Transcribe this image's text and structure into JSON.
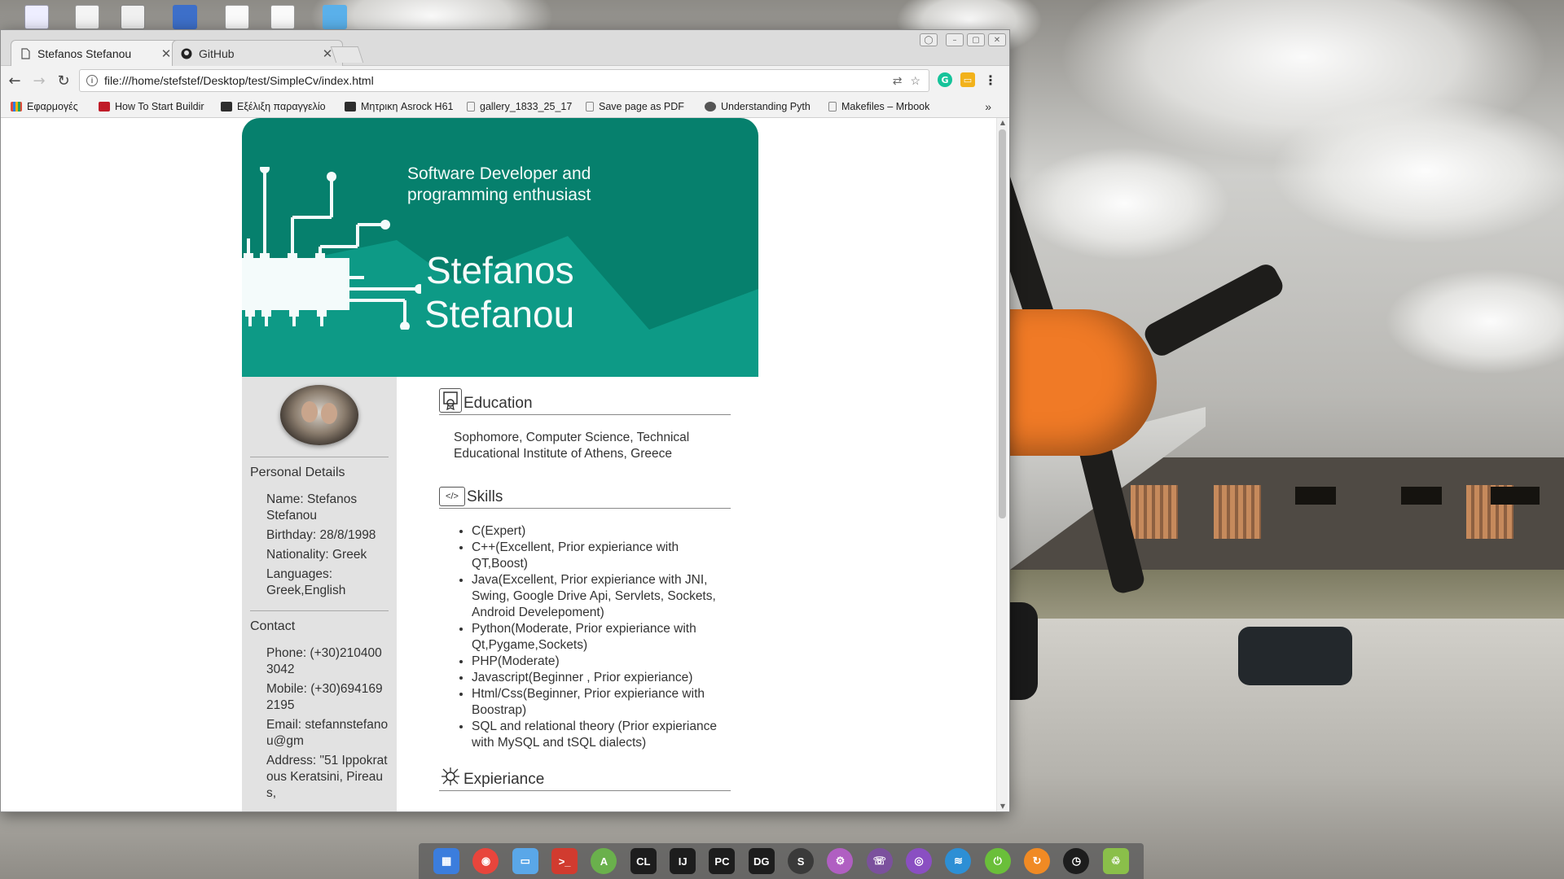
{
  "browser": {
    "tabs": [
      {
        "title": "Stefanos Stefanou",
        "active": true
      },
      {
        "title": "GitHub",
        "active": false
      }
    ],
    "url": "file:///home/stefstef/Desktop/test/SimpleCv/index.html",
    "bookmarks": [
      {
        "label": "Εφαρμογές",
        "icon": "apps-grid-icon",
        "color": "#e04a3a"
      },
      {
        "label": "How To Start Buildir",
        "icon": "bookmark-favicon",
        "color": "#c01c28"
      },
      {
        "label": "Εξέλιξη παραγγελίο",
        "icon": "bookmark-favicon",
        "color": "#2d2d2d"
      },
      {
        "label": "Μητρικη Asrock H61",
        "icon": "bookmark-favicon",
        "color": "#2d2d2d"
      },
      {
        "label": "gallery_1833_25_17",
        "icon": "page-icon",
        "color": "#888888"
      },
      {
        "label": "Save page as PDF",
        "icon": "page-icon",
        "color": "#888888"
      },
      {
        "label": "Understanding Pyth",
        "icon": "person-favicon",
        "color": "#555555"
      },
      {
        "label": "Makefiles – Mrbook",
        "icon": "page-icon",
        "color": "#888888"
      }
    ],
    "more_label": "»"
  },
  "cv": {
    "tagline": "Software Developer and programming enthusiast",
    "first_name": "Stefanos",
    "last_name": "Stefanou",
    "personal_heading": "Personal Details",
    "personal": [
      "Name: Stefanos Stefanou",
      "Birthday: 28/8/1998",
      "Nationality: Greek",
      "Languages: Greek,English"
    ],
    "contact_heading": "Contact",
    "contact": [
      "Phone: (+30)2104003042",
      "Mobile: (+30)6941692195",
      "Email: stefannstefanou@gm",
      "Address: \"51 Ippokratous Keratsini, Pireaus,"
    ],
    "education_heading": "Education",
    "education_text": "Sophomore, Computer Science, Technical Educational Institute of Athens, Greece",
    "skills_heading": "Skills",
    "skills": [
      "C(Expert)",
      "C++(Excellent, Prior expieriance with QT,Boost)",
      "Java(Excellent, Prior expieriance with JNI, Swing, Google Drive Api, Servlets, Sockets, Android Develepoment)",
      "Python(Moderate, Prior expieriance with Qt,Pygame,Sockets)",
      "PHP(Moderate)",
      "Javascript(Beginner , Prior expieriance)",
      "Html/Css(Beginner, Prior expieriance with Boostrap)",
      "SQL and relational theory (Prior expieriance with MySQL and tSQL dialects)"
    ],
    "experience_heading": "Expieriance"
  },
  "colors": {
    "hero_dark": "#06806d",
    "hero_light": "#0d9a86",
    "sidebar_bg": "#e2e2e2"
  },
  "dock": [
    {
      "name": "app-launcher-icon",
      "color": "#3b7ddd",
      "glyph": "▦"
    },
    {
      "name": "chrome-icon",
      "color": "#e8453c",
      "glyph": "◉"
    },
    {
      "name": "files-icon",
      "color": "#5aa7e8",
      "glyph": "▭"
    },
    {
      "name": "terminal-icon",
      "color": "#d13b2f",
      "glyph": ">_"
    },
    {
      "name": "android-studio-icon",
      "color": "#6ab04c",
      "glyph": "A"
    },
    {
      "name": "clion-icon",
      "color": "#1d1d1d",
      "glyph": "CL"
    },
    {
      "name": "intellij-icon",
      "color": "#1d1d1d",
      "glyph": "IJ"
    },
    {
      "name": "pycharm-icon",
      "color": "#1d1d1d",
      "glyph": "PC"
    },
    {
      "name": "datagrip-icon",
      "color": "#1d1d1d",
      "glyph": "DG"
    },
    {
      "name": "sublime-icon",
      "color": "#3a3a3a",
      "glyph": "S"
    },
    {
      "name": "settings-icon",
      "color": "#b05fc2",
      "glyph": "⚙"
    },
    {
      "name": "viber-icon",
      "color": "#7b519d",
      "glyph": "☏"
    },
    {
      "name": "screenshot-icon",
      "color": "#8a4fc2",
      "glyph": "◎"
    },
    {
      "name": "wifi-icon",
      "color": "#2d8fd5",
      "glyph": "≋"
    },
    {
      "name": "power-icon",
      "color": "#6abf3a",
      "glyph": "⏻"
    },
    {
      "name": "update-icon",
      "color": "#f08a24",
      "glyph": "↻"
    },
    {
      "name": "clock-icon",
      "color": "#1d1d1d",
      "glyph": "◷"
    },
    {
      "name": "trash-icon",
      "color": "#8abf4a",
      "glyph": "♲"
    }
  ]
}
